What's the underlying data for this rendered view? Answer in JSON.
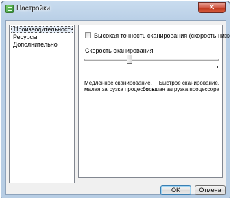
{
  "window": {
    "title": "Настройки",
    "close_glyph": "✕",
    "app_icon": "settings-app-icon"
  },
  "sidebar": {
    "items": [
      {
        "label": "Производительность",
        "selected": true
      },
      {
        "label": "Ресурсы",
        "selected": false
      },
      {
        "label": "Дополнительно",
        "selected": false
      }
    ]
  },
  "performance": {
    "high_accuracy_label": "Высокая точность сканирования (скорость ниже)",
    "high_accuracy_checked": false,
    "scan_speed_label": "Скорость сканирования",
    "scan_speed_fraction": 0.33,
    "slow_hint_line1": "Медленное сканирование,",
    "slow_hint_line2": "малая загрузка процессора",
    "fast_hint_line1": "Быстрое сканирование,",
    "fast_hint_line2": "большая загрузка процессора"
  },
  "buttons": {
    "ok": "OK",
    "cancel": "Отмена"
  }
}
